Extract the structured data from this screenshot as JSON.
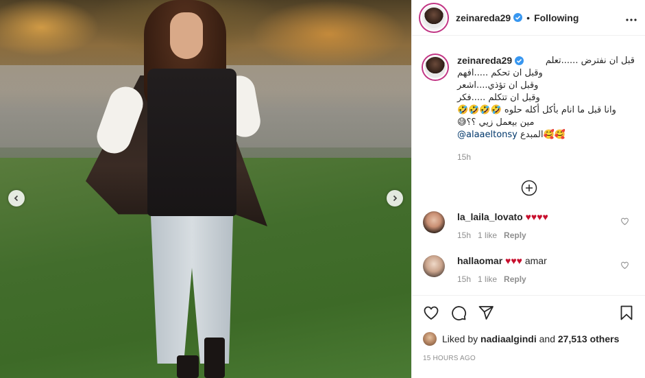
{
  "post": {
    "username": "zeinareda29",
    "follow_status": "Following",
    "separator": "•",
    "more_icon": "more-horizontal-icon",
    "image_alt": ""
  },
  "caption": {
    "username": "zeinareda29",
    "lines": [
      "قبل ان نفترض ......تعلم",
      "وقبل ان تحكم .....افهم",
      "وقبل ان تؤذي....اشعر",
      "وقبل ان تتكلم .....فكر",
      "وانا قبل ما انام بأكل أكله حلوه 🤣🤣🤣🤣",
      "مين بيعمل زيي ؟؟😅",
      "المبدع🥰🥰"
    ],
    "mention": "@alaaeltonsy",
    "time": "15h"
  },
  "comments": [
    {
      "username": "la_laila_lovato",
      "text": "",
      "hearts": "♥♥♥♥",
      "time": "15h",
      "likes": "1 like",
      "reply": "Reply"
    },
    {
      "username": "hallaomar",
      "text": "amar",
      "hearts": "♥♥♥",
      "time": "15h",
      "likes": "1 like",
      "reply": "Reply"
    }
  ],
  "likes": {
    "prefix": "Liked by",
    "user": "nadiaalgindi",
    "connector": "and",
    "count": "27,513 others"
  },
  "post_time": "15 HOURS AGO",
  "colors": {
    "verified": "#3897f0",
    "heart": "#c8102e",
    "muted": "#8e8e8e",
    "text": "#262626"
  }
}
